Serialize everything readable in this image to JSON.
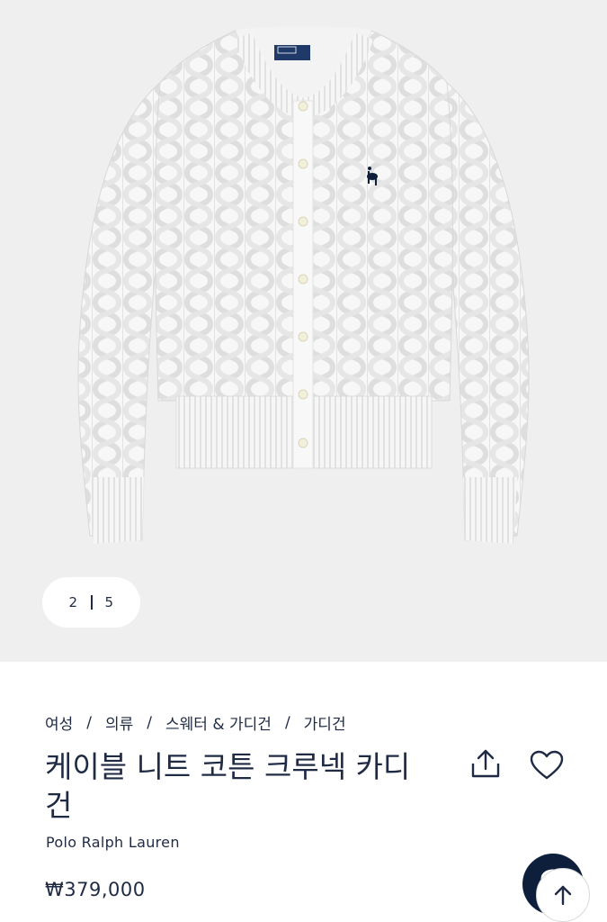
{
  "gallery": {
    "current": "2",
    "total": "5",
    "label_badge": "Polo by Ralph Lauren"
  },
  "breadcrumb": {
    "items": [
      "여성",
      "의류",
      "스웨터 & 가디건",
      "가디건"
    ],
    "separator": "/"
  },
  "product": {
    "title": "케이블 니트 코튼 크루넥 카디건",
    "brand": "Polo Ralph Lauren",
    "price": "₩379,000"
  },
  "actions": {
    "share_icon": "share-icon",
    "wishlist_icon": "heart-icon",
    "chat_icon": "chat-icon",
    "back_to_top_icon": "arrow-up-icon"
  },
  "colors": {
    "text": "#1f2a44",
    "hero_bg": "#efefef",
    "chat_bg": "#0e1f3c"
  }
}
